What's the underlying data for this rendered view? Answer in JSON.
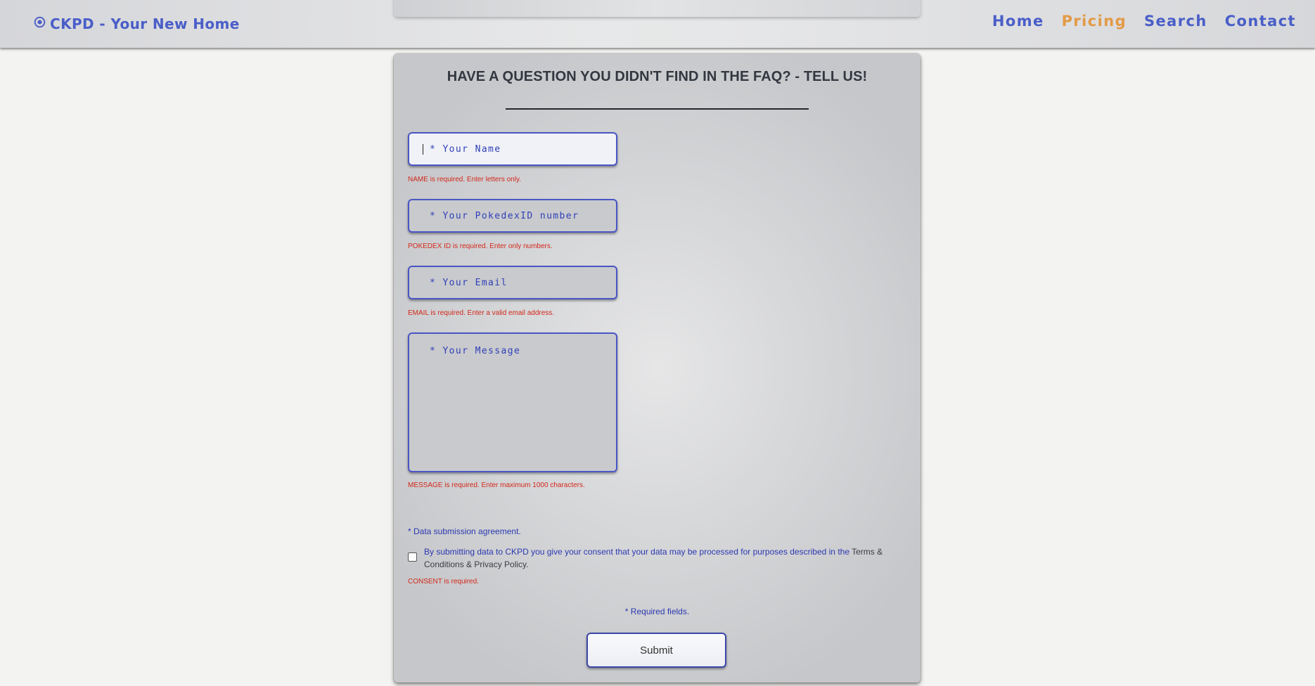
{
  "header": {
    "brand": "CKPD - Your New Home",
    "brand_icon": "radio-circle-icon",
    "nav": [
      {
        "label": "Home",
        "active": false
      },
      {
        "label": "Pricing",
        "active": true
      },
      {
        "label": "Search",
        "active": false
      },
      {
        "label": "Contact",
        "active": false
      }
    ],
    "colors": {
      "link": "#4a5ec8",
      "active": "#e39a45"
    }
  },
  "form": {
    "title": "HAVE A QUESTION YOU DIDN'T FIND IN THE FAQ? - TELL US!",
    "name_placeholder": "* Your Name",
    "name_error": "NAME is required. Enter letters only.",
    "pokedex_placeholder": "* Your PokedexID number",
    "pokedex_error": "POKEDEX ID is required. Enter only numbers.",
    "email_placeholder": "* Your Email",
    "email_error": "EMAIL is required. Enter a valid email address.",
    "message_placeholder": "* Your Message",
    "message_error": "MESSAGE is required. Enter maximum 1000 characters.",
    "agreement_label": "* Data submission agreement.",
    "consent_text": "By submitting data to CKPD you give your consent that your data may be processed for purposes described in the ",
    "consent_link": "Terms & Conditions & Privacy Policy.",
    "consent_error": "CONSENT is required.",
    "required_note": "* Required fields.",
    "submit_label": "Submit"
  }
}
